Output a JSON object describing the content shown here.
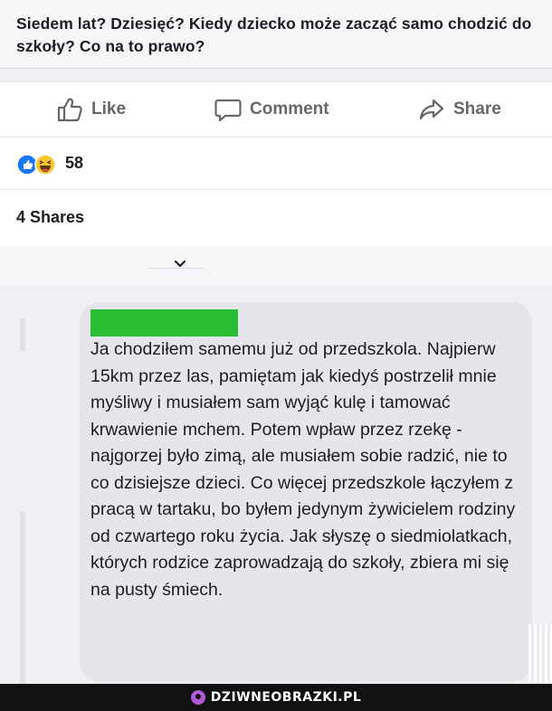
{
  "post": {
    "link_title": "Siedem lat? Dziesięć? Kiedy dziecko może zacząć samo chodzić do szkoły? Co na to prawo?"
  },
  "actions": {
    "like_label": "Like",
    "comment_label": "Comment",
    "share_label": "Share"
  },
  "reactions": {
    "icons": [
      "like-reaction-icon",
      "haha-reaction-icon"
    ],
    "count": "58"
  },
  "shares": {
    "text": "4 Shares"
  },
  "comment": {
    "author_redacted": true,
    "text": "Ja chodziłem samemu już od przedszkola. Najpierw 15km przez las, pamiętam jak kiedyś postrzelił mnie myśliwy i musiałem sam wyjąć kulę i tamować krwawienie mchem. Potem wpław przez rzekę - najgorzej było zimą, ale musiałem sobie radzić, nie to co dzisiejsze dzieci. Co więcej przedszkole łączyłem z pracą w tartaku, bo byłem jedynym żywicielem rodziny od czwartego roku życia. Jak słyszę o siedmiolatkach, których rodzice zaprowadzają do szkoły, zbiera mi się na pusty śmiech."
  },
  "footer": {
    "brand": "DZIWNEOBRAZKI.PL"
  },
  "colors": {
    "accent_blue": "#1877f2",
    "redaction_green": "#2bbd34",
    "bubble_gray": "#e4e6eb",
    "action_gray": "#65676b"
  }
}
